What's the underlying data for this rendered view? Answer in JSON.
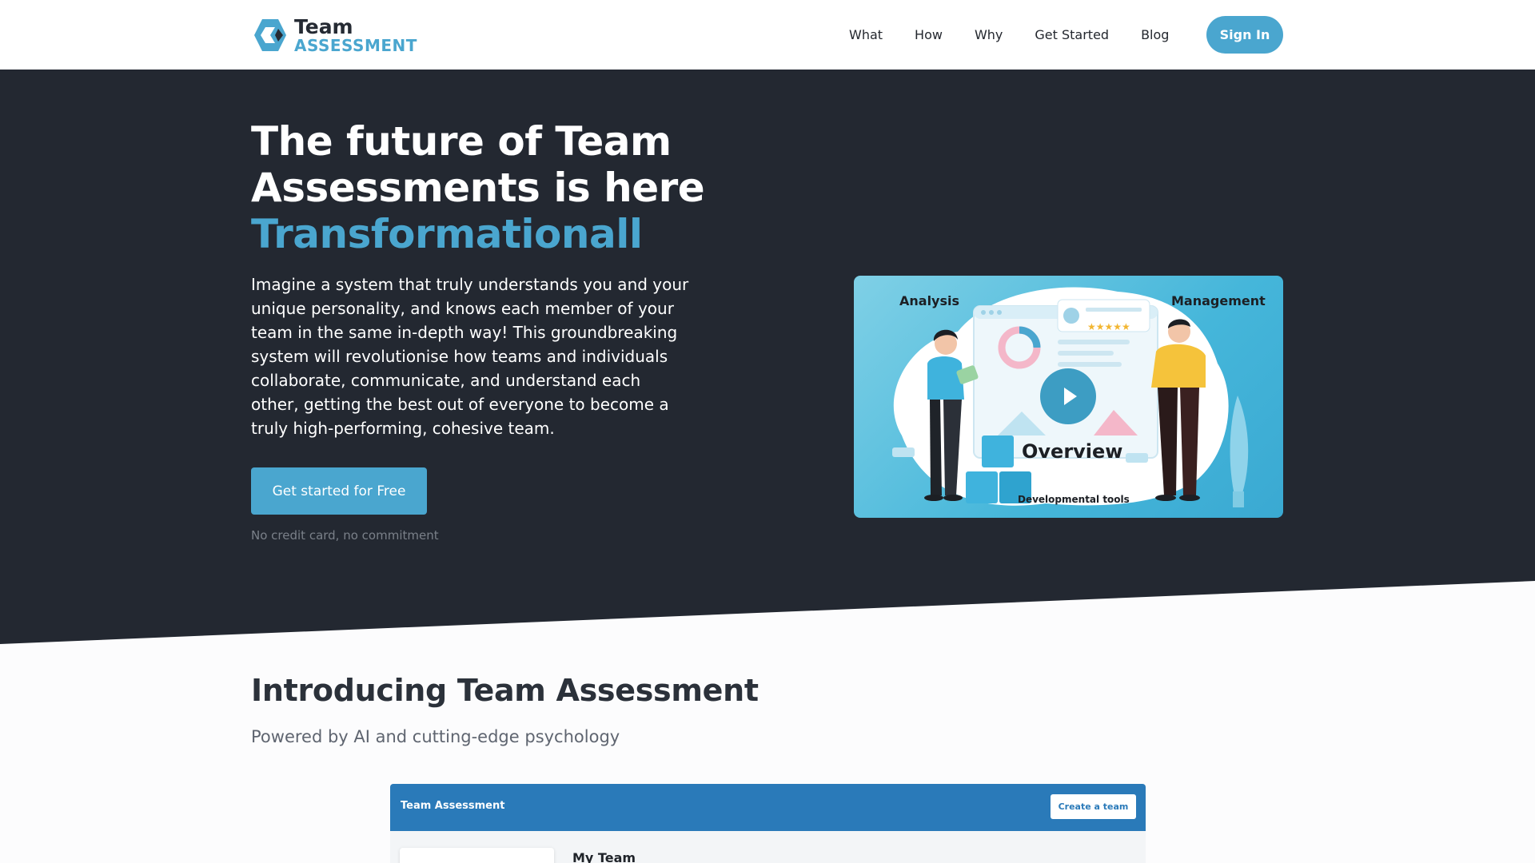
{
  "header": {
    "logo": {
      "line1": "Team",
      "line2": "ASSESSMENT",
      "icon": "team-assessment-logo-icon"
    },
    "nav": [
      {
        "label": "What"
      },
      {
        "label": "How"
      },
      {
        "label": "Why"
      },
      {
        "label": "Get Started"
      },
      {
        "label": "Blog"
      }
    ],
    "signin_label": "Sign In"
  },
  "hero": {
    "title": "The future of Team Assessments is here",
    "accent": "Transformationall",
    "body": "Imagine a system that truly understands you and your unique personality, and knows each member of your team in the same in-depth way! This groundbreaking system will revolutionise how teams and individuals collaborate, communicate, and understand each other, getting the best out of everyone to become a truly high-performing, cohesive team.",
    "cta_label": "Get started for Free",
    "cta_note": "No credit card, no commitment"
  },
  "video": {
    "label_left": "Analysis",
    "label_right": "Management",
    "label_center": "Overview",
    "label_bottom": "Developmental tools",
    "play_icon": "play-icon"
  },
  "intro": {
    "title": "Introducing Team Assessment",
    "subtitle": "Powered by AI and cutting-edge psychology"
  },
  "app_preview": {
    "title": "Team Assessment",
    "button_label": "Create a team",
    "heading": "My Team"
  },
  "colors": {
    "accent": "#4aa6cf",
    "hero_bg": "#232831",
    "app_bar": "#2a7ab9"
  }
}
